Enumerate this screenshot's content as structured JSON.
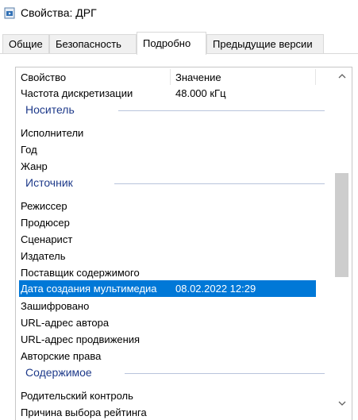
{
  "window": {
    "title": "Свойства: ДРГ"
  },
  "tabs": [
    {
      "label": "Общие"
    },
    {
      "label": "Безопасность"
    },
    {
      "label": "Подробно"
    },
    {
      "label": "Предыдущие версии"
    }
  ],
  "table": {
    "headers": {
      "property": "Свойство",
      "value": "Значение"
    },
    "rows": [
      {
        "kind": "row",
        "label": "Частота дискретизации",
        "value": "48.000 кГц"
      },
      {
        "kind": "group",
        "label": "Носитель"
      },
      {
        "kind": "row",
        "label": "Исполнители",
        "value": ""
      },
      {
        "kind": "row",
        "label": "Год",
        "value": ""
      },
      {
        "kind": "row",
        "label": "Жанр",
        "value": ""
      },
      {
        "kind": "group",
        "label": "Источник"
      },
      {
        "kind": "row",
        "label": "Режиссер",
        "value": ""
      },
      {
        "kind": "row",
        "label": "Продюсер",
        "value": ""
      },
      {
        "kind": "row",
        "label": "Сценарист",
        "value": ""
      },
      {
        "kind": "row",
        "label": "Издатель",
        "value": ""
      },
      {
        "kind": "row",
        "label": "Поставщик содержимого",
        "value": ""
      },
      {
        "kind": "row",
        "label": "Дата создания мультимедиа",
        "value": "08.02.2022 12:29",
        "selected": true
      },
      {
        "kind": "row",
        "label": "Зашифровано",
        "value": ""
      },
      {
        "kind": "row",
        "label": "URL-адрес автора",
        "value": ""
      },
      {
        "kind": "row",
        "label": "URL-адрес продвижения",
        "value": ""
      },
      {
        "kind": "row",
        "label": "Авторские права",
        "value": ""
      },
      {
        "kind": "group",
        "label": "Содержимое"
      },
      {
        "kind": "row",
        "label": "Родительский контроль",
        "value": ""
      },
      {
        "kind": "row",
        "label": "Причина выбора рейтинга",
        "value": ""
      }
    ]
  },
  "icons": {
    "app": "media-file-icon",
    "scroll_up": "chevron-up-icon",
    "scroll_down": "chevron-down-icon"
  },
  "colors": {
    "selection": "#0078d7",
    "group_text": "#1e3a8a",
    "scroll_thumb": "#cdcdcd"
  }
}
